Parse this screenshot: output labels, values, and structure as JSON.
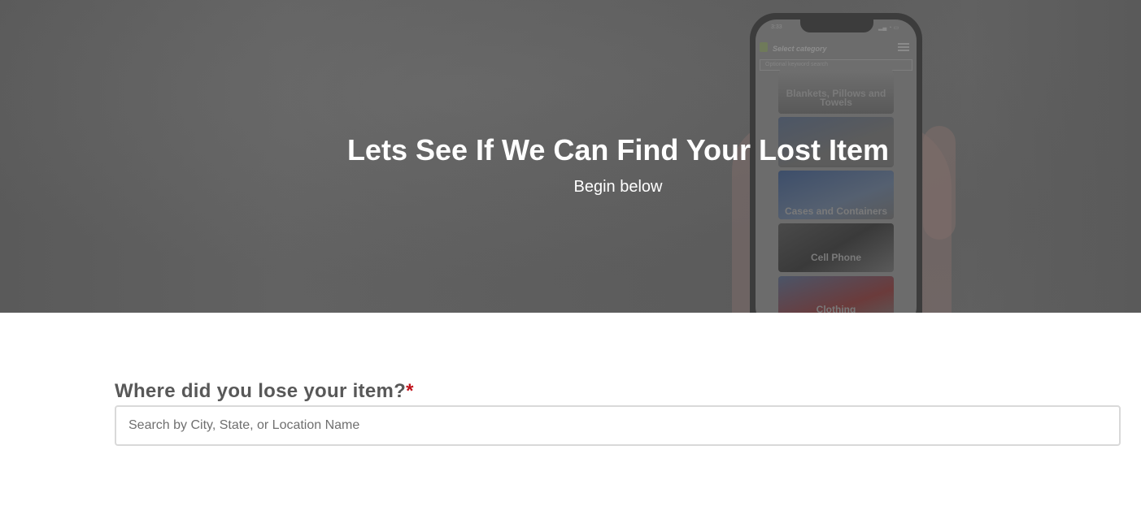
{
  "hero": {
    "title": "Lets See If We Can Find Your Lost Item",
    "subtitle": "Begin below",
    "background_color": "#5f5f5f"
  },
  "phone_mockup": {
    "time": "3:33",
    "app_title": "Select category",
    "search_placeholder": "Optional keyword search",
    "categories": [
      "Blankets, Pillows and Towels",
      "Cases and Containers",
      "Cell Phone",
      "Clothing"
    ]
  },
  "form": {
    "location_label": "Where did you lose your item?",
    "required_marker": "*",
    "required_color": "#c0121b",
    "location_placeholder": "Search by City, State, or Location Name",
    "location_value": ""
  }
}
